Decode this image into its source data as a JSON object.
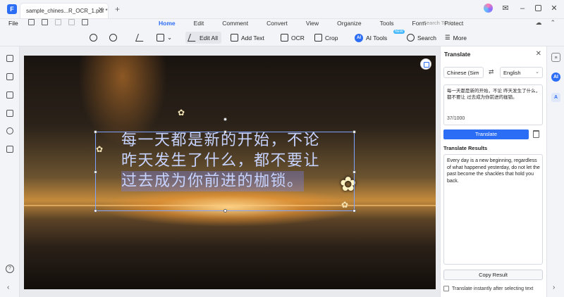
{
  "titlebar": {
    "tab_title": "sample_chines...R_OCR_1.pdf *",
    "tab_close": "✕",
    "tab_add": "+",
    "window_buttons": {
      "minimize": "–",
      "close": "✕"
    }
  },
  "menubar": {
    "file": "File",
    "tabs": [
      {
        "label": "Home",
        "active": true
      },
      {
        "label": "Edit",
        "active": false
      },
      {
        "label": "Comment",
        "active": false
      },
      {
        "label": "Convert",
        "active": false
      },
      {
        "label": "View",
        "active": false
      },
      {
        "label": "Organize",
        "active": false
      },
      {
        "label": "Tools",
        "active": false
      },
      {
        "label": "Form",
        "active": false
      },
      {
        "label": "Protect",
        "active": false
      }
    ],
    "search_tools": "Search Tools"
  },
  "toolbar": {
    "edit_all": "Edit All",
    "add_text": "Add Text",
    "ocr": "OCR",
    "crop": "Crop",
    "ai_tools": "AI Tools",
    "ai_icon": "AI",
    "new_badge": "NEW",
    "search": "Search",
    "more": "More"
  },
  "document": {
    "lines": [
      "每一天都是新的开始，不论",
      "昨天发生了什么，都不要让",
      "过去成为你前进的枷锁。"
    ]
  },
  "translate_panel": {
    "title": "Translate",
    "source_lang": "Chinese (Sim",
    "target_lang": "English",
    "source_text": "每一天都是新的开始，不论 昨天发生了什么，都不要让 过去成为你前进的枷锁。",
    "char_count": "37/1000",
    "translate_button": "Translate",
    "results_label": "Translate Results",
    "result_text": "Every day is a new beginning, regardless of what happened yesterday, do not let the past become the shackles that hold you back.",
    "copy_button": "Copy Result",
    "instant_label": "Translate instantly after selecting text"
  },
  "right_strip": {
    "ai_label": "AI",
    "translate_icon": "A"
  },
  "colors": {
    "accent": "#2c6df5",
    "panel_bg": "#ffffff",
    "chrome_bg": "#f3f4f7"
  }
}
